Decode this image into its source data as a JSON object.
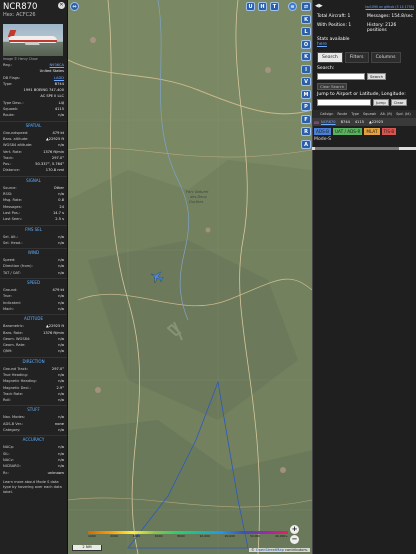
{
  "info": {
    "callsign": "NCR870",
    "hex": "Hex: ACFC26",
    "photo_credit": "Image © Henry Chow",
    "fields": [
      {
        "k": "Reg.:",
        "v": "N936CA",
        "link": true
      },
      {
        "k": "",
        "v": "United States",
        "link": false
      },
      {
        "k": "DB Flags:",
        "v": "LADD",
        "link": true
      },
      {
        "k": "Type:",
        "v": "B744",
        "link": false
      }
    ],
    "type_desc": "1991 BOEING 747-400",
    "owner": "AC SPE II LLC",
    "fields2": [
      {
        "k": "Type Desc.:",
        "v": "L4J"
      },
      {
        "k": "Squawk:",
        "v": "4115"
      },
      {
        "k": "Route:",
        "v": "n/a"
      }
    ],
    "sections": [
      {
        "title": "SPATIAL",
        "rows": [
          {
            "k": "Groundspeed:",
            "v": "479 kt"
          },
          {
            "k": "Baro. altitude:",
            "v": "▲22925 ft"
          },
          {
            "k": "WGS84 altitude:",
            "v": "n/a"
          },
          {
            "k": "Vert. Rate:",
            "v": "1376 ft/min"
          },
          {
            "k": "Track:",
            "v": "297.0°"
          },
          {
            "k": "Pos.:",
            "v": "50.337°, 5.764°"
          },
          {
            "k": "Distance:",
            "v": "170.8 nmi"
          }
        ]
      },
      {
        "title": "SIGNAL",
        "rows": [
          {
            "k": "Source:",
            "v": "Other"
          },
          {
            "k": "RSSI:",
            "v": "n/a"
          },
          {
            "k": "Msg. Rate:",
            "v": "0.8"
          },
          {
            "k": "Messages:",
            "v": "24"
          },
          {
            "k": "Last Pos.:",
            "v": "14.7 s"
          },
          {
            "k": "Last Seen:",
            "v": "2.5 s"
          }
        ]
      },
      {
        "title": "FMS SEL",
        "rows": [
          {
            "k": "Sel. Alt.:",
            "v": "n/a"
          },
          {
            "k": "Sel. Head.:",
            "v": "n/a"
          }
        ]
      },
      {
        "title": "WIND",
        "rows": [
          {
            "k": "Speed:",
            "v": "n/a"
          },
          {
            "k": "Direction (from):",
            "v": "n/a"
          },
          {
            "k": "TAT / OAT:",
            "v": "n/a"
          }
        ]
      },
      {
        "title": "SPEED",
        "rows": [
          {
            "k": "Ground:",
            "v": "479 kt"
          },
          {
            "k": "True:",
            "v": "n/a"
          },
          {
            "k": "Indicated:",
            "v": "n/a"
          },
          {
            "k": "Mach:",
            "v": "n/a"
          }
        ]
      },
      {
        "title": "ALTITUDE",
        "rows": [
          {
            "k": "Barometric:",
            "v": "▲22925 ft"
          },
          {
            "k": "Baro. Rate:",
            "v": "1376 ft/min"
          },
          {
            "k": "Geom. WGS84:",
            "v": "n/a"
          },
          {
            "k": "Geom. Rate:",
            "v": "n/a"
          },
          {
            "k": "QNH:",
            "v": "n/a"
          }
        ]
      },
      {
        "title": "DIRECTION",
        "rows": [
          {
            "k": "Ground Track:",
            "v": "297.0°"
          },
          {
            "k": "True Heading:",
            "v": "n/a"
          },
          {
            "k": "Magnetic Heading:",
            "v": "n/a"
          },
          {
            "k": "Magnetic Decl.:",
            "v": "2.9°"
          },
          {
            "k": "Track Rate:",
            "v": "n/a"
          },
          {
            "k": "Roll:",
            "v": "n/a"
          }
        ]
      },
      {
        "title": "STUFF",
        "rows": [
          {
            "k": "Nav. Modes:",
            "v": "n/a"
          },
          {
            "k": "ADS-B Ver.:",
            "v": "none"
          },
          {
            "k": "Category:",
            "v": "n/a"
          }
        ]
      },
      {
        "title": "ACCURACY",
        "rows": [
          {
            "k": "NACp:",
            "v": "n/a"
          },
          {
            "k": "SIL:",
            "v": "n/a"
          },
          {
            "k": "NACv:",
            "v": "n/a"
          },
          {
            "k": "NICBARO:",
            "v": "n/a"
          },
          {
            "k": "Rc:",
            "v": "unknown"
          }
        ]
      }
    ],
    "note": "Learn more about Mode S data type by hovering over each data label."
  },
  "map": {
    "top_buttons": [
      "U",
      "H",
      "T"
    ],
    "left_button_icon": "arrows-icon",
    "scale_label": "2 NM",
    "alt_ticks": [
      "1000",
      "2000",
      "4000",
      "6000",
      "8000",
      "10,000",
      "20,000",
      "30,000",
      "40,000+"
    ],
    "place_labels": [
      "Parc Naturel",
      "des Deux",
      "Ourthes"
    ],
    "zoom_in": "+",
    "zoom_out": "−",
    "attribution_prefix": "© ",
    "attribution_link": "OpenStreetMap",
    "attribution_suffix": " contributors."
  },
  "strip_buttons": [
    "⇄",
    "K",
    "L",
    "O",
    "K",
    "I",
    "V",
    "M",
    "P",
    "F",
    "R",
    "A"
  ],
  "right": {
    "arrows": "◀▶",
    "version": "tar1090 on github (3 14 1755)",
    "total_label": "Total Aircraft: 1",
    "messages_label": "Messages: 154.8/sec",
    "withpos_label": "With Position: 1",
    "history_label": "History: 2126 positions",
    "stats_label": "Stats available",
    "donate": "here",
    "tabs": [
      "Search",
      "Filters",
      "Columns"
    ],
    "search_label": "Search:",
    "search_button": "Search",
    "clear_search": "Clear Search",
    "jump_label": "Jump to Airport or Latitude, Longitude:",
    "jump_button": "Jump",
    "clear_button": "Clear",
    "columns": [
      "Callsign",
      "Route",
      "Type",
      "Squawk",
      "Alt. (ft)",
      "Spd. (kt)"
    ],
    "row": {
      "callsign": "NCR870",
      "type": "B744",
      "squawk": "4115",
      "alt": "▲22925"
    },
    "legend": [
      {
        "label": "ADS-B",
        "color": "#4a7fd6"
      },
      {
        "label": "UAT / ADS-R",
        "color": "#59b35e"
      },
      {
        "label": "MLAT",
        "color": "#e6a23c"
      },
      {
        "label": "TIS-B",
        "color": "#d9534f"
      }
    ],
    "modes_label": "Mode-S"
  }
}
